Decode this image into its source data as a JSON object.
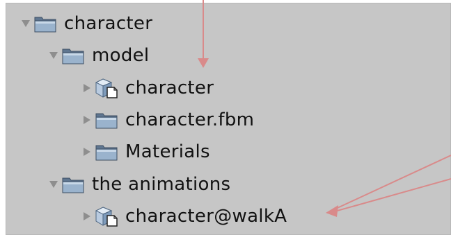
{
  "tree": {
    "items": [
      {
        "label": "character",
        "type": "folder",
        "expanded": true
      },
      {
        "label": "model",
        "type": "folder",
        "expanded": true
      },
      {
        "label": "character",
        "type": "model",
        "expanded": false
      },
      {
        "label": "character.fbm",
        "type": "folder",
        "expanded": false
      },
      {
        "label": "Materials",
        "type": "folder",
        "expanded": false
      },
      {
        "label": "the animations",
        "type": "folder",
        "expanded": true
      },
      {
        "label": "character@walkA",
        "type": "model",
        "expanded": false
      }
    ]
  },
  "colors": {
    "panel_background": "#c6c6c6",
    "annotation_arrow": "#d98a8a",
    "folder_blue": "#8fa9c4"
  }
}
